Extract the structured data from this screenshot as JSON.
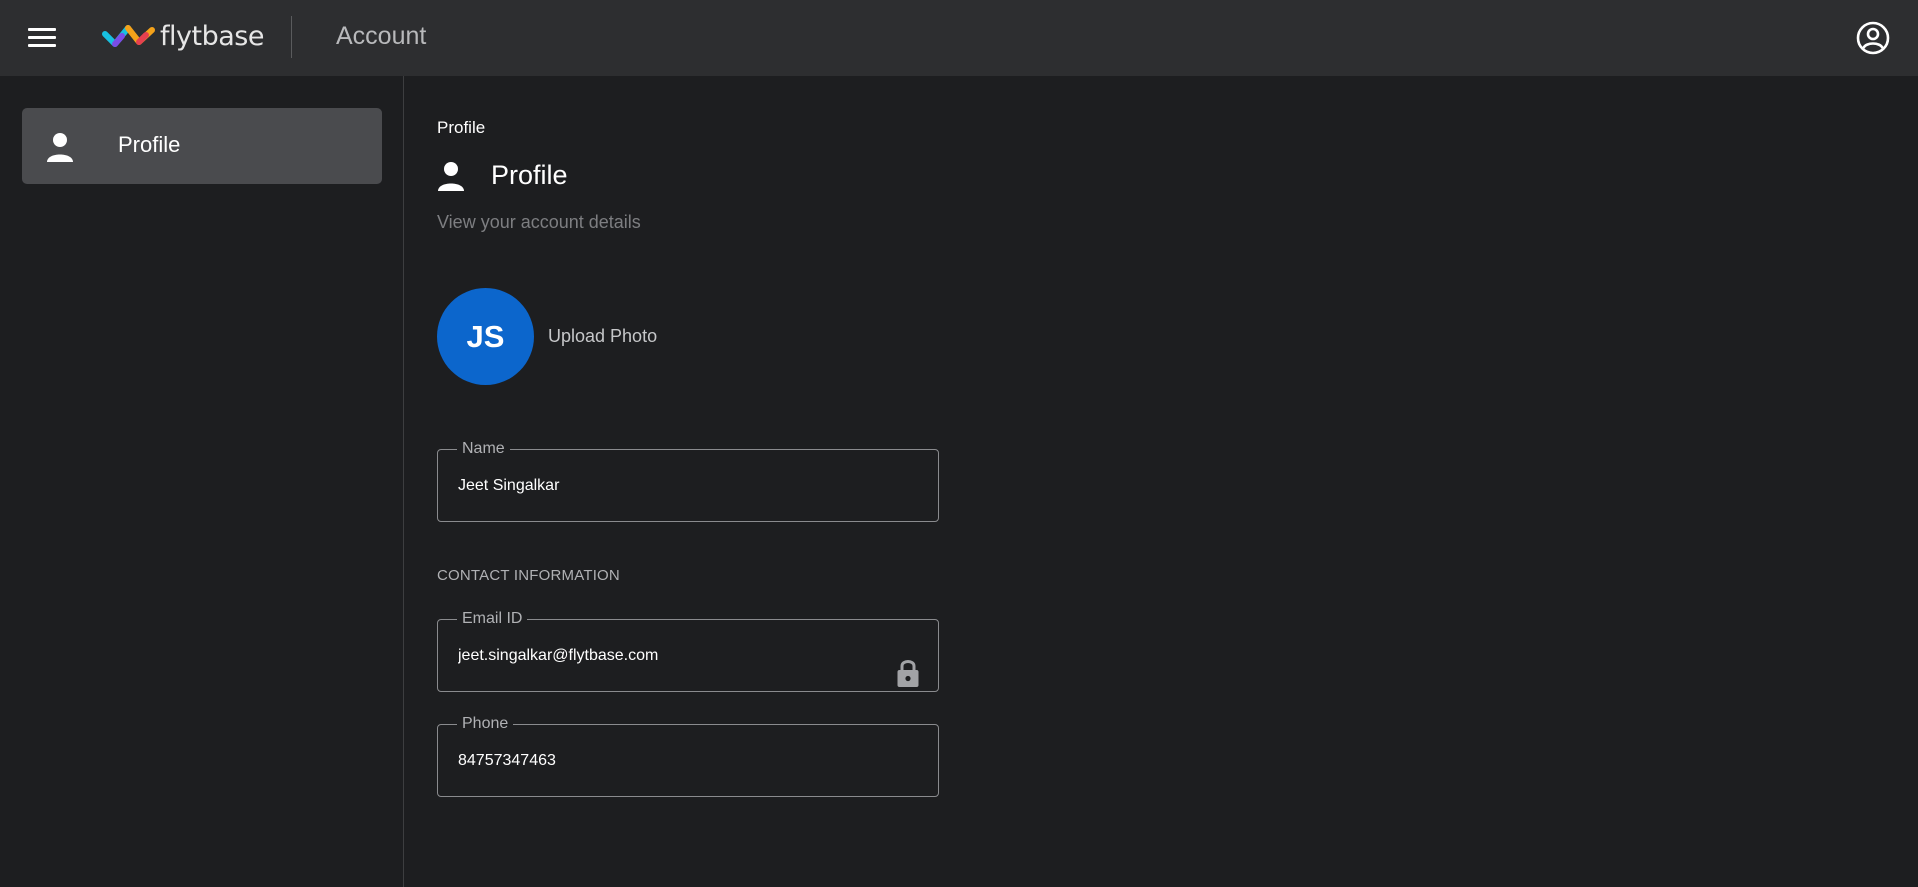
{
  "header": {
    "logo_text": "flytbase",
    "app_title": "Account",
    "menu_icon": "hamburger-menu-icon",
    "account_icon": "account-circle-icon"
  },
  "sidebar": {
    "items": [
      {
        "label": "Profile",
        "icon": "person-icon",
        "active": true
      }
    ]
  },
  "main": {
    "breadcrumb": "Profile",
    "title": "Profile",
    "subtitle": "View your account details",
    "avatar_initials": "JS",
    "upload_label": "Upload Photo",
    "name_field": {
      "label": "Name",
      "value": "Jeet Singalkar"
    },
    "contact_section_label": "CONTACT INFORMATION",
    "email_field": {
      "label": "Email ID",
      "value": "jeet.singalkar@flytbase.com",
      "icon": "lock-icon"
    },
    "phone_field": {
      "label": "Phone",
      "value": "84757347463"
    }
  },
  "colors": {
    "background": "#1d1e20",
    "topbar": "#2d2e30",
    "sidebar_active": "#4a4b4e",
    "avatar": "#0c66cc"
  }
}
